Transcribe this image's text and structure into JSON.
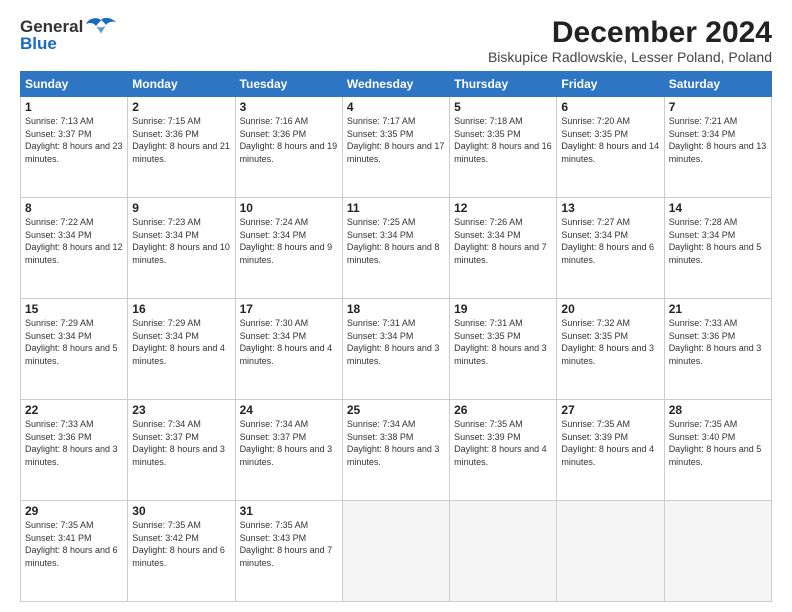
{
  "logo": {
    "line1": "General",
    "line2": "Blue"
  },
  "title": "December 2024",
  "subtitle": "Biskupice Radlowskie, Lesser Poland, Poland",
  "columns": [
    "Sunday",
    "Monday",
    "Tuesday",
    "Wednesday",
    "Thursday",
    "Friday",
    "Saturday"
  ],
  "weeks": [
    [
      {
        "day": "1",
        "sunrise": "7:13 AM",
        "sunset": "3:37 PM",
        "daylight": "8 hours and 23 minutes."
      },
      {
        "day": "2",
        "sunrise": "7:15 AM",
        "sunset": "3:36 PM",
        "daylight": "8 hours and 21 minutes."
      },
      {
        "day": "3",
        "sunrise": "7:16 AM",
        "sunset": "3:36 PM",
        "daylight": "8 hours and 19 minutes."
      },
      {
        "day": "4",
        "sunrise": "7:17 AM",
        "sunset": "3:35 PM",
        "daylight": "8 hours and 17 minutes."
      },
      {
        "day": "5",
        "sunrise": "7:18 AM",
        "sunset": "3:35 PM",
        "daylight": "8 hours and 16 minutes."
      },
      {
        "day": "6",
        "sunrise": "7:20 AM",
        "sunset": "3:35 PM",
        "daylight": "8 hours and 14 minutes."
      },
      {
        "day": "7",
        "sunrise": "7:21 AM",
        "sunset": "3:34 PM",
        "daylight": "8 hours and 13 minutes."
      }
    ],
    [
      {
        "day": "8",
        "sunrise": "7:22 AM",
        "sunset": "3:34 PM",
        "daylight": "8 hours and 12 minutes."
      },
      {
        "day": "9",
        "sunrise": "7:23 AM",
        "sunset": "3:34 PM",
        "daylight": "8 hours and 10 minutes."
      },
      {
        "day": "10",
        "sunrise": "7:24 AM",
        "sunset": "3:34 PM",
        "daylight": "8 hours and 9 minutes."
      },
      {
        "day": "11",
        "sunrise": "7:25 AM",
        "sunset": "3:34 PM",
        "daylight": "8 hours and 8 minutes."
      },
      {
        "day": "12",
        "sunrise": "7:26 AM",
        "sunset": "3:34 PM",
        "daylight": "8 hours and 7 minutes."
      },
      {
        "day": "13",
        "sunrise": "7:27 AM",
        "sunset": "3:34 PM",
        "daylight": "8 hours and 6 minutes."
      },
      {
        "day": "14",
        "sunrise": "7:28 AM",
        "sunset": "3:34 PM",
        "daylight": "8 hours and 5 minutes."
      }
    ],
    [
      {
        "day": "15",
        "sunrise": "7:29 AM",
        "sunset": "3:34 PM",
        "daylight": "8 hours and 5 minutes."
      },
      {
        "day": "16",
        "sunrise": "7:29 AM",
        "sunset": "3:34 PM",
        "daylight": "8 hours and 4 minutes."
      },
      {
        "day": "17",
        "sunrise": "7:30 AM",
        "sunset": "3:34 PM",
        "daylight": "8 hours and 4 minutes."
      },
      {
        "day": "18",
        "sunrise": "7:31 AM",
        "sunset": "3:34 PM",
        "daylight": "8 hours and 3 minutes."
      },
      {
        "day": "19",
        "sunrise": "7:31 AM",
        "sunset": "3:35 PM",
        "daylight": "8 hours and 3 minutes."
      },
      {
        "day": "20",
        "sunrise": "7:32 AM",
        "sunset": "3:35 PM",
        "daylight": "8 hours and 3 minutes."
      },
      {
        "day": "21",
        "sunrise": "7:33 AM",
        "sunset": "3:36 PM",
        "daylight": "8 hours and 3 minutes."
      }
    ],
    [
      {
        "day": "22",
        "sunrise": "7:33 AM",
        "sunset": "3:36 PM",
        "daylight": "8 hours and 3 minutes."
      },
      {
        "day": "23",
        "sunrise": "7:34 AM",
        "sunset": "3:37 PM",
        "daylight": "8 hours and 3 minutes."
      },
      {
        "day": "24",
        "sunrise": "7:34 AM",
        "sunset": "3:37 PM",
        "daylight": "8 hours and 3 minutes."
      },
      {
        "day": "25",
        "sunrise": "7:34 AM",
        "sunset": "3:38 PM",
        "daylight": "8 hours and 3 minutes."
      },
      {
        "day": "26",
        "sunrise": "7:35 AM",
        "sunset": "3:39 PM",
        "daylight": "8 hours and 4 minutes."
      },
      {
        "day": "27",
        "sunrise": "7:35 AM",
        "sunset": "3:39 PM",
        "daylight": "8 hours and 4 minutes."
      },
      {
        "day": "28",
        "sunrise": "7:35 AM",
        "sunset": "3:40 PM",
        "daylight": "8 hours and 5 minutes."
      }
    ],
    [
      {
        "day": "29",
        "sunrise": "7:35 AM",
        "sunset": "3:41 PM",
        "daylight": "8 hours and 6 minutes."
      },
      {
        "day": "30",
        "sunrise": "7:35 AM",
        "sunset": "3:42 PM",
        "daylight": "8 hours and 6 minutes."
      },
      {
        "day": "31",
        "sunrise": "7:35 AM",
        "sunset": "3:43 PM",
        "daylight": "8 hours and 7 minutes."
      },
      null,
      null,
      null,
      null
    ]
  ],
  "labels": {
    "sunrise": "Sunrise:",
    "sunset": "Sunset:",
    "daylight": "Daylight:"
  },
  "accent_color": "#2e75c4"
}
